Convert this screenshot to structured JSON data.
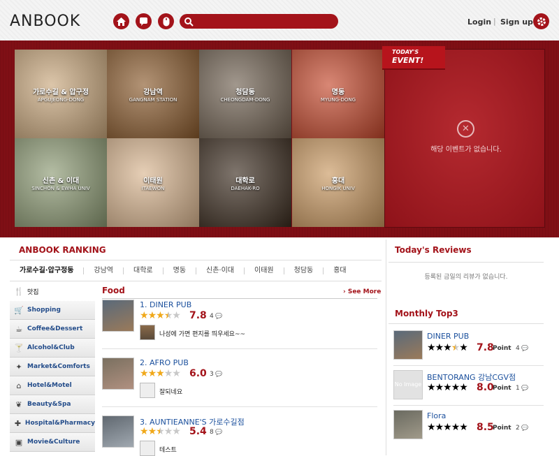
{
  "header": {
    "logo": "ANBOOK",
    "login": "Login",
    "separator": "|",
    "signup": "Sign up",
    "icons": [
      "home-icon",
      "chat-icon",
      "mouse-icon",
      "search-icon",
      "gear-icon"
    ],
    "search_value": ""
  },
  "banner": {
    "areas": [
      {
        "ko": "가로수길 & 압구정",
        "en": "APGUJEONG-DONG",
        "color": "#c9a77c"
      },
      {
        "ko": "강남역",
        "en": "GANGNAM STATION",
        "color": "#8a5a2c"
      },
      {
        "ko": "청담동",
        "en": "CHEONGDAM-DONG",
        "color": "#6f6050"
      },
      {
        "ko": "명동",
        "en": "MYUNG-DONG",
        "color": "#c4472b"
      },
      {
        "ko": "신촌 & 이대",
        "en": "SINCHON & EWHA UNIV",
        "color": "#8c9a73"
      },
      {
        "ko": "이태원",
        "en": "ITAEWON",
        "color": "#d9b58f"
      },
      {
        "ko": "대학로",
        "en": "DAEHAK-RO",
        "color": "#3a2b1e"
      },
      {
        "ko": "홍대",
        "en": "HONGIK UNIV",
        "color": "#c99860"
      }
    ],
    "event_ribbon_top": "TODAY'S",
    "event_ribbon_bottom": "EVENT!",
    "event_message": "해당 이벤트가 없습니다."
  },
  "ranking": {
    "title": "ANBOOK RANKING",
    "tabs": [
      "가로수길·압구정동",
      "강남역",
      "대학로",
      "명동",
      "신촌·이대",
      "이태원",
      "청담동",
      "홍대"
    ],
    "active_tab": 0,
    "categories": [
      {
        "label": "맛집",
        "icon": "utensils-icon",
        "glyph": "🍴"
      },
      {
        "label": "Shopping",
        "icon": "cart-icon",
        "glyph": "🛒"
      },
      {
        "label": "Coffee&Dessert",
        "icon": "coffee-icon",
        "glyph": "☕"
      },
      {
        "label": "Alcohol&Club",
        "icon": "wine-glass-icon",
        "glyph": "🍸"
      },
      {
        "label": "Market&Comforts",
        "icon": "person-icon",
        "glyph": "✦"
      },
      {
        "label": "Hotel&Motel",
        "icon": "house-icon",
        "glyph": "⌂"
      },
      {
        "label": "Beauty&Spa",
        "icon": "leaf-icon",
        "glyph": "❦"
      },
      {
        "label": "Hospital&Pharmacy",
        "icon": "medical-icon",
        "glyph": "✚"
      },
      {
        "label": "Movie&Culture",
        "icon": "film-icon",
        "glyph": "▣"
      }
    ],
    "food_title": "Food",
    "see_more": "› See More",
    "items": [
      {
        "name": "1. DINER PUB",
        "rating": 3.5,
        "score": "7.8",
        "count": "4",
        "comment": "나성에 가면 편지를 띄우세요~~"
      },
      {
        "name": "2. AFRO PUB",
        "rating": 3.0,
        "score": "6.0",
        "count": "3",
        "comment": "잘되네요"
      },
      {
        "name": "3. AUNTIEANNE'S 가로수길점",
        "rating": 2.5,
        "score": "5.4",
        "count": "8",
        "comment": "테스트"
      }
    ]
  },
  "reviews": {
    "title": "Today's Reviews",
    "empty": "등록된 금일의 리뷰가 없습니다."
  },
  "top3": {
    "title": "Monthly Top3",
    "items": [
      {
        "name": "DINER PUB",
        "rating": 3.5,
        "score": "7.8",
        "point": "Point",
        "count": "4",
        "noimage": false
      },
      {
        "name": "BENTORANG 강남CGV점",
        "rating": 4.0,
        "score": "8.0",
        "point": "Point",
        "count": "1",
        "noimage": true,
        "noimage_text": "No Image"
      },
      {
        "name": "Flora",
        "rating": 4.0,
        "score": "8.5",
        "point": "Point",
        "count": "2",
        "noimage": false
      }
    ]
  },
  "colors": {
    "accent": "#a3131a",
    "link": "#1a4f9c",
    "star": "#f0a819"
  }
}
